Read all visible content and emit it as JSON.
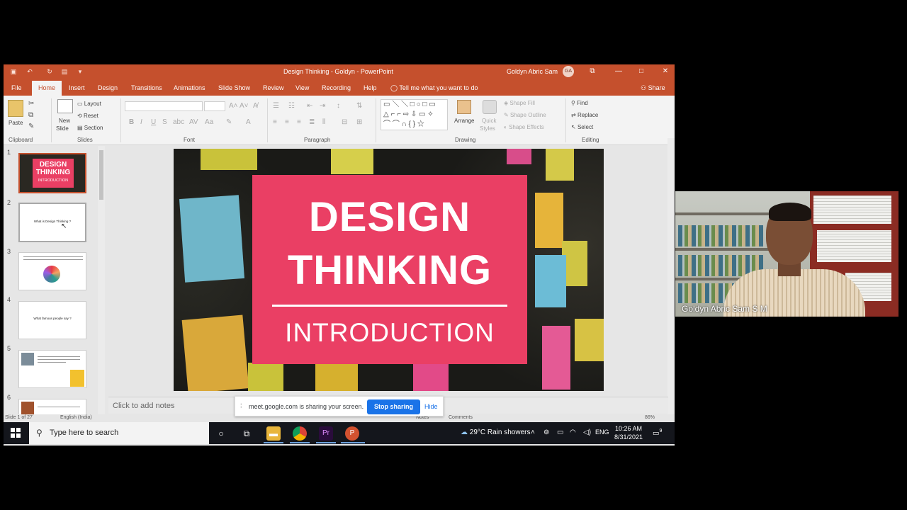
{
  "window": {
    "title": "Design Thinking - Goldyn  -  PowerPoint",
    "user_name": "Goldyn Abric Sam",
    "user_initials": "GA",
    "accent_color": "#c5502d"
  },
  "tabs": [
    "File",
    "Home",
    "Insert",
    "Design",
    "Transitions",
    "Animations",
    "Slide Show",
    "Review",
    "View",
    "Recording",
    "Help"
  ],
  "active_tab": "Home",
  "tell_me": "Tell me what you want to do",
  "share_label": "Share",
  "ribbon": {
    "clipboard": {
      "paste": "Paste",
      "group": "Clipboard"
    },
    "slides": {
      "new_slide_1": "New",
      "new_slide_2": "Slide",
      "layout": "Layout",
      "reset": "Reset",
      "section": "Section",
      "group": "Slides"
    },
    "font": {
      "group": "Font",
      "aa_label": "Aa"
    },
    "paragraph": {
      "group": "Paragraph"
    },
    "drawing": {
      "arrange": "Arrange",
      "quick_styles_1": "Quick",
      "quick_styles_2": "Styles",
      "shape_fill": "Shape Fill",
      "shape_outline": "Shape Outline",
      "shape_effects": "Shape Effects",
      "group": "Drawing"
    },
    "editing": {
      "find": "Find",
      "replace": "Replace",
      "select": "Select",
      "group": "Editing"
    }
  },
  "thumbnails": [
    {
      "num": "1",
      "title_1": "DESIGN",
      "title_2": "THINKING",
      "subtitle": "INTRODUCTION"
    },
    {
      "num": "2",
      "text": "What is Design Thinking ?"
    },
    {
      "num": "3"
    },
    {
      "num": "4",
      "text": "What famous people say ?"
    },
    {
      "num": "5"
    },
    {
      "num": "6"
    }
  ],
  "slide": {
    "line1": "DESIGN",
    "line2": "THINKING",
    "line3": "INTRODUCTION",
    "card_color": "#ea3f64"
  },
  "notes_placeholder": "Click to add notes",
  "status": {
    "slide_of": "Slide 1 of 27",
    "language": "English (India)",
    "notes": "Notes",
    "comments": "Comments",
    "zoom": "86%"
  },
  "share_banner": {
    "message": "meet.google.com is sharing your screen.",
    "stop": "Stop sharing",
    "hide": "Hide"
  },
  "taskbar": {
    "search_placeholder": "Type here to search",
    "weather": "29°C  Rain showers",
    "lang": "ENG",
    "time": "10:26 AM",
    "date": "8/31/2021",
    "notif_count": "9"
  },
  "webcam": {
    "participant": "Goldyn Abric Sam S M"
  }
}
